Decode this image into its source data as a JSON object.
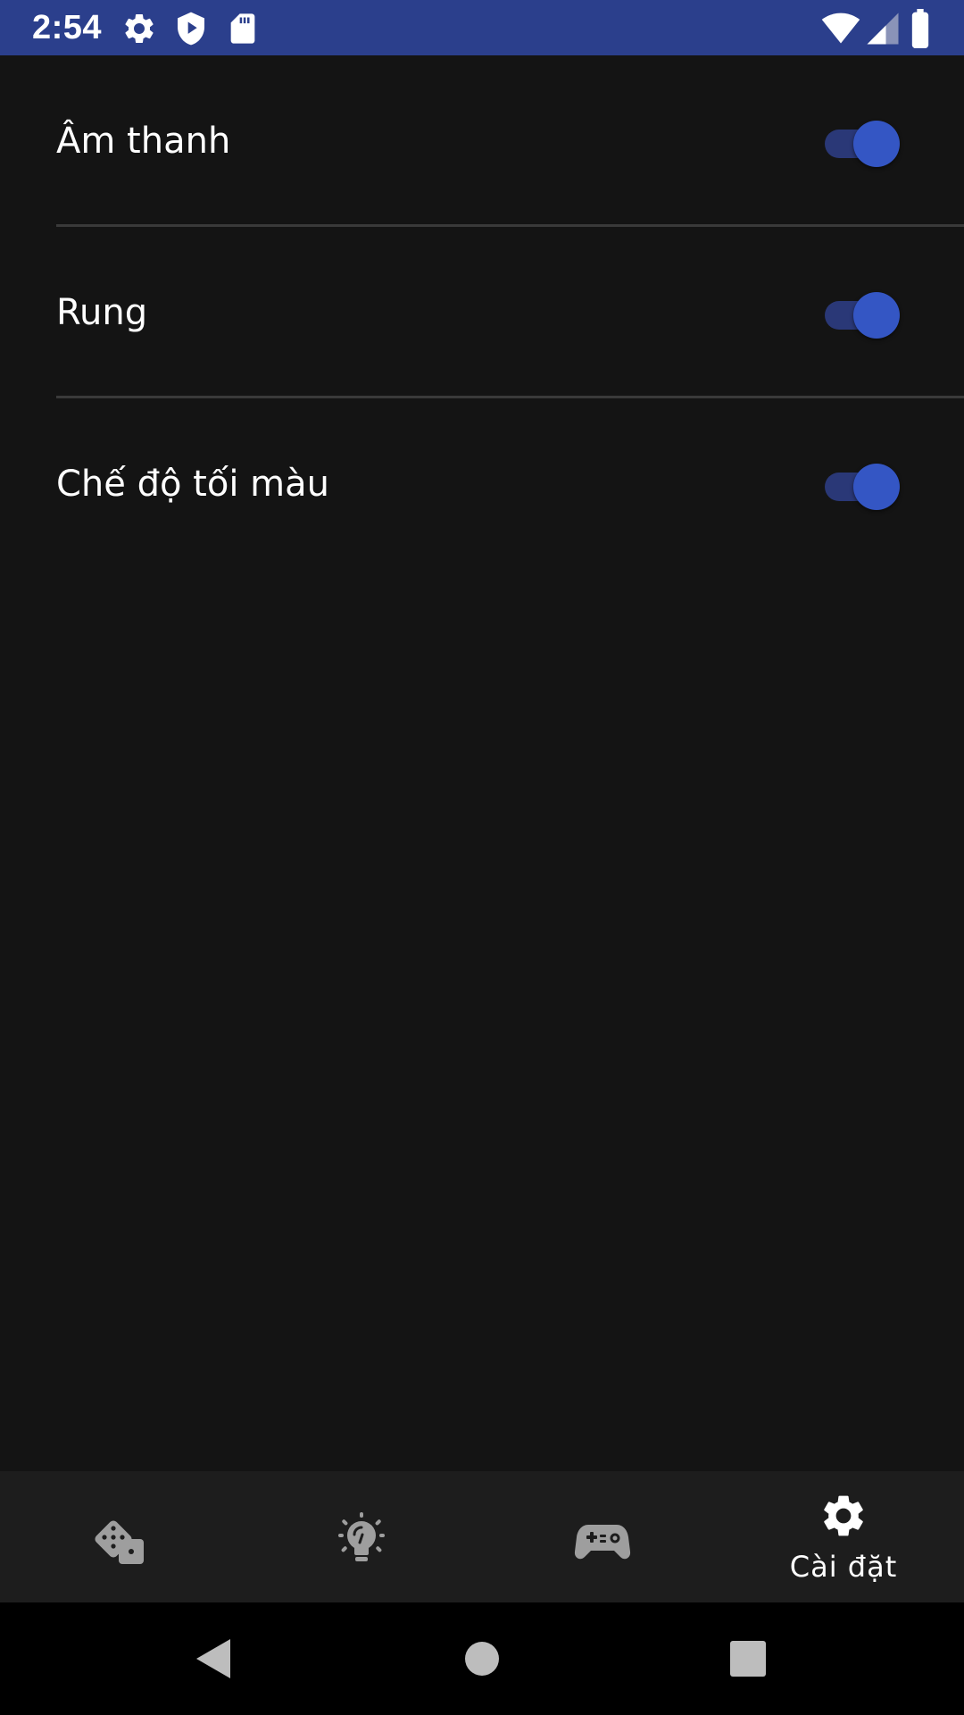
{
  "status_bar": {
    "time": "2:54",
    "background": "#2b3f8c",
    "left_icons": [
      "gear-icon",
      "shield-play-icon",
      "sd-card-icon"
    ],
    "right_icons": [
      "wifi-icon",
      "cellular-signal-icon",
      "battery-icon"
    ]
  },
  "settings": {
    "items": [
      {
        "label": "Âm thanh",
        "enabled": true
      },
      {
        "label": "Rung",
        "enabled": true
      },
      {
        "label": "Chế độ tối màu",
        "enabled": true
      }
    ]
  },
  "colors": {
    "background": "#141414",
    "toggle_thumb_on": "#3456c4",
    "toggle_track_on": "#2a3877",
    "nav_background": "#1d1d1d",
    "inactive_icon": "#9e9e9e"
  },
  "bottom_nav": {
    "items": [
      {
        "icon": "dice-icon",
        "label": "",
        "active": false
      },
      {
        "icon": "lightbulb-icon",
        "label": "",
        "active": false
      },
      {
        "icon": "gamepad-icon",
        "label": "",
        "active": false
      },
      {
        "icon": "gear-icon",
        "label": "Cài đặt",
        "active": true
      }
    ]
  },
  "system_nav": {
    "buttons": [
      "back-icon",
      "home-icon",
      "recents-icon"
    ]
  }
}
